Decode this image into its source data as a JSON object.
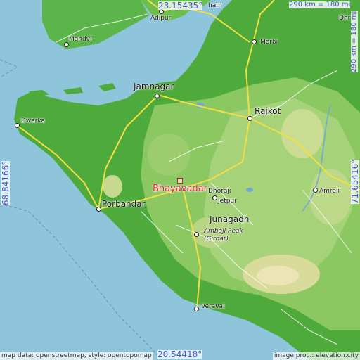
{
  "map": {
    "type": "topographic location map",
    "colors": {
      "sea": "#8fc5da",
      "lowland": "#4faa3c",
      "midland": "#9fcf6d",
      "highland": "#e6dfa6",
      "road_major": "#f2de45",
      "road_minor": "#ffffff",
      "marker": "#d6282e",
      "coord_text": "#4455cc"
    }
  },
  "labels": {
    "target": "Bhayavadar",
    "jamnagar": "Jamnagar",
    "rajkot": "Rajkot",
    "porbandar": "Porbandar",
    "junagadh": "Junagadh",
    "dwarka": "Dwarka",
    "mandvi": "Mandvi",
    "adipur": "Adipur",
    "morbi": "Morbi",
    "amreli": "Amreli",
    "veraval": "Veraval",
    "jetpur": "Jetpur",
    "dhoraji": "Dhoraji",
    "dhr": "Dhr",
    "ham": "ham",
    "peak_line1": "Ambaji Peak",
    "peak_line2": "(Girnar)"
  },
  "coordinates": {
    "top": "23.15435°",
    "bottom": "20.54418°",
    "left": "68.84166°",
    "right": "71.65416°"
  },
  "scale": {
    "horizontal": "290 km = 180 mi",
    "vertical": "290 km = 180 mi"
  },
  "credits": {
    "left": "map data: openstreetmap, style: opentopomap",
    "right": "image proc.: elevation.city"
  }
}
